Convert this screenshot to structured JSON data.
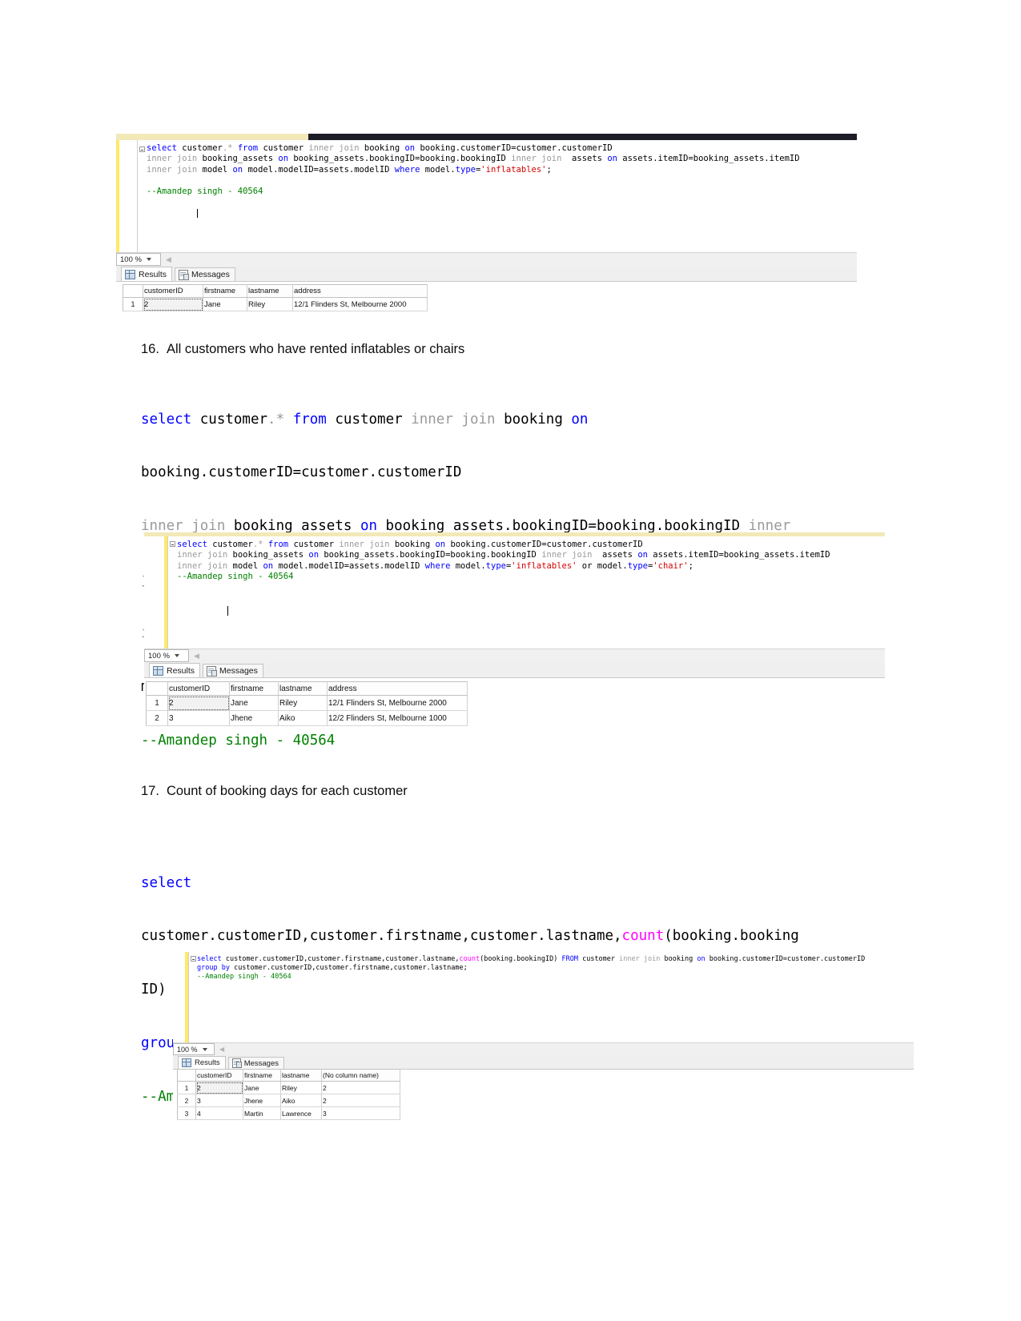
{
  "document": {
    "sections": [
      {
        "number": "16.",
        "title": "All customers who have rented inflatables or chairs",
        "code_lines": [
          [
            {
              "t": "select",
              "c": "kw"
            },
            {
              "t": " customer",
              "c": "pln"
            },
            {
              "t": ".",
              "c": "gray"
            },
            {
              "t": "*",
              "c": "gray"
            },
            {
              "t": " ",
              "c": "pln"
            },
            {
              "t": "from",
              "c": "kw"
            },
            {
              "t": " customer ",
              "c": "pln"
            },
            {
              "t": "inner join",
              "c": "gray"
            },
            {
              "t": " booking ",
              "c": "pln"
            },
            {
              "t": "on",
              "c": "kw"
            }
          ],
          [
            {
              "t": "booking.customerID=customer.customerID",
              "c": "pln"
            }
          ],
          [
            {
              "t": "inner join",
              "c": "gray"
            },
            {
              "t": " booking_assets ",
              "c": "pln"
            },
            {
              "t": "on",
              "c": "kw"
            },
            {
              "t": " booking_assets.bookingID=booking.bookingID ",
              "c": "pln"
            },
            {
              "t": "inner",
              "c": "gray"
            }
          ],
          [
            {
              "t": "join",
              "c": "gray"
            },
            {
              "t": "  assets ",
              "c": "pln"
            },
            {
              "t": "on",
              "c": "kw"
            },
            {
              "t": " assets.itemID=booking_assets.itemID",
              "c": "pln"
            }
          ],
          [
            {
              "t": "inner join",
              "c": "gray"
            },
            {
              "t": " model ",
              "c": "pln"
            },
            {
              "t": "on",
              "c": "kw"
            },
            {
              "t": " model.modelID=assets.modelID ",
              "c": "pln"
            },
            {
              "t": "where",
              "c": "kw"
            }
          ],
          [
            {
              "t": "model.",
              "c": "pln"
            },
            {
              "t": "type",
              "c": "kw"
            },
            {
              "t": "=",
              "c": "pln"
            },
            {
              "t": "'inflatables'",
              "c": "str"
            },
            {
              "t": " or model.",
              "c": "pln"
            },
            {
              "t": "type",
              "c": "kw"
            },
            {
              "t": "=",
              "c": "pln"
            },
            {
              "t": "'chair'",
              "c": "str"
            },
            {
              "t": ";",
              "c": "pln"
            }
          ],
          [
            {
              "t": "--Amandep singh - 40564",
              "c": "cmt"
            }
          ]
        ]
      },
      {
        "number": "17.",
        "title": "Count of booking days for each customer",
        "code_lines": [
          [
            {
              "t": "select",
              "c": "kw"
            }
          ],
          [
            {
              "t": "customer.customerID,customer.firstname,customer.lastname,",
              "c": "pln"
            },
            {
              "t": "count",
              "c": "mag"
            },
            {
              "t": "(booking.booking",
              "c": "pln"
            }
          ],
          [
            {
              "t": "ID) ",
              "c": "pln"
            },
            {
              "t": "FROM",
              "c": "kw"
            },
            {
              "t": " customer ",
              "c": "pln"
            },
            {
              "t": "inner join",
              "c": "gray"
            },
            {
              "t": " booking ",
              "c": "pln"
            },
            {
              "t": "on",
              "c": "kw"
            },
            {
              "t": " booking.customerID=customer.customerID",
              "c": "pln"
            }
          ],
          [
            {
              "t": "group by",
              "c": "kw"
            },
            {
              "t": " customer.customerID,customer.firstname,customer.lastname;",
              "c": "pln"
            }
          ],
          [
            {
              "t": "--Amandep singh - 40564",
              "c": "cmt"
            }
          ]
        ]
      }
    ]
  },
  "screenshot_1": {
    "editor_lines": [
      [
        {
          "t": "select",
          "c": "kw"
        },
        {
          "t": " customer",
          "c": "pln"
        },
        {
          "t": ".*",
          "c": "gray"
        },
        {
          "t": " ",
          "c": "pln"
        },
        {
          "t": "from",
          "c": "kw"
        },
        {
          "t": " customer ",
          "c": "pln"
        },
        {
          "t": "inner join",
          "c": "gray"
        },
        {
          "t": " booking ",
          "c": "pln"
        },
        {
          "t": "on",
          "c": "kw"
        },
        {
          "t": " booking.customerID=customer.customerID",
          "c": "pln"
        }
      ],
      [
        {
          "t": "inner join",
          "c": "gray"
        },
        {
          "t": " booking_assets ",
          "c": "pln"
        },
        {
          "t": "on",
          "c": "kw"
        },
        {
          "t": " booking_assets.bookingID=booking.bookingID ",
          "c": "pln"
        },
        {
          "t": "inner join",
          "c": "gray"
        },
        {
          "t": "  assets ",
          "c": "pln"
        },
        {
          "t": "on",
          "c": "kw"
        },
        {
          "t": " assets.itemID=booking_assets.itemID",
          "c": "pln"
        }
      ],
      [
        {
          "t": "inner join",
          "c": "gray"
        },
        {
          "t": " model ",
          "c": "pln"
        },
        {
          "t": "on",
          "c": "kw"
        },
        {
          "t": " model.modelID=assets.modelID ",
          "c": "pln"
        },
        {
          "t": "where",
          "c": "kw"
        },
        {
          "t": " model.",
          "c": "pln"
        },
        {
          "t": "type",
          "c": "kw"
        },
        {
          "t": "=",
          "c": "pln"
        },
        {
          "t": "'inflatables'",
          "c": "str"
        },
        {
          "t": ";",
          "c": "pln"
        }
      ],
      [],
      [
        {
          "t": "--Amandep singh - 40564",
          "c": "cmt"
        }
      ]
    ],
    "zoom_level": "100 %",
    "tabs": [
      {
        "label": "Results",
        "icon": "grid-icon",
        "active": true
      },
      {
        "label": "Messages",
        "icon": "message-icon",
        "active": false
      }
    ],
    "grid": {
      "columns": [
        "",
        "customerID",
        "firstname",
        "lastname",
        "address"
      ],
      "rows": [
        [
          "1",
          "2",
          "Jane",
          "Riley",
          "12/1 Flinders St, Melbourne 2000"
        ]
      ]
    }
  },
  "screenshot_2": {
    "editor_lines": [
      [
        {
          "t": "select",
          "c": "kw"
        },
        {
          "t": " customer",
          "c": "pln"
        },
        {
          "t": ".*",
          "c": "gray"
        },
        {
          "t": " ",
          "c": "pln"
        },
        {
          "t": "from",
          "c": "kw"
        },
        {
          "t": " customer ",
          "c": "pln"
        },
        {
          "t": "inner join",
          "c": "gray"
        },
        {
          "t": " booking ",
          "c": "pln"
        },
        {
          "t": "on",
          "c": "kw"
        },
        {
          "t": " booking.customerID=customer.customerID",
          "c": "pln"
        }
      ],
      [
        {
          "t": "inner join",
          "c": "gray"
        },
        {
          "t": " booking_assets ",
          "c": "pln"
        },
        {
          "t": "on",
          "c": "kw"
        },
        {
          "t": " booking_assets.bookingID=booking.bookingID ",
          "c": "pln"
        },
        {
          "t": "inner join",
          "c": "gray"
        },
        {
          "t": "  assets ",
          "c": "pln"
        },
        {
          "t": "on",
          "c": "kw"
        },
        {
          "t": " assets.itemID=booking_assets.itemID",
          "c": "pln"
        }
      ],
      [
        {
          "t": "inner join",
          "c": "gray"
        },
        {
          "t": " model ",
          "c": "pln"
        },
        {
          "t": "on",
          "c": "kw"
        },
        {
          "t": " model.modelID=assets.modelID ",
          "c": "pln"
        },
        {
          "t": "where",
          "c": "kw"
        },
        {
          "t": " model.",
          "c": "pln"
        },
        {
          "t": "type",
          "c": "kw"
        },
        {
          "t": "=",
          "c": "pln"
        },
        {
          "t": "'inflatables'",
          "c": "str"
        },
        {
          "t": " or model.",
          "c": "pln"
        },
        {
          "t": "type",
          "c": "kw"
        },
        {
          "t": "=",
          "c": "pln"
        },
        {
          "t": "'chair'",
          "c": "str"
        },
        {
          "t": ";",
          "c": "pln"
        }
      ],
      [
        {
          "t": "--Amandep singh - 40564",
          "c": "cmt"
        }
      ]
    ],
    "zoom_level": "100 %",
    "tabs": [
      {
        "label": "Results",
        "icon": "grid-icon",
        "active": true
      },
      {
        "label": "Messages",
        "icon": "message-icon",
        "active": false
      }
    ],
    "grid": {
      "columns": [
        "",
        "customerID",
        "firstname",
        "lastname",
        "address"
      ],
      "rows": [
        [
          "1",
          "2",
          "Jane",
          "Riley",
          "12/1 Flinders St, Melbourne 2000"
        ],
        [
          "2",
          "3",
          "Jhene",
          "Aiko",
          "12/2 Flinders St, Melbourne 1000"
        ]
      ]
    }
  },
  "screenshot_3": {
    "editor_lines": [
      [
        {
          "t": "select",
          "c": "kw"
        },
        {
          "t": " customer.customerID,customer.firstname,customer.lastname,",
          "c": "pln"
        },
        {
          "t": "count",
          "c": "mag"
        },
        {
          "t": "(booking.bookingID) ",
          "c": "pln"
        },
        {
          "t": "FROM",
          "c": "kw"
        },
        {
          "t": " customer ",
          "c": "pln"
        },
        {
          "t": "inner join",
          "c": "gray"
        },
        {
          "t": " booking ",
          "c": "pln"
        },
        {
          "t": "on",
          "c": "kw"
        },
        {
          "t": " booking.customerID=customer.customerID",
          "c": "pln"
        }
      ],
      [
        {
          "t": "group by",
          "c": "kw"
        },
        {
          "t": " customer.customerID,customer.firstname,customer.lastname;",
          "c": "pln"
        }
      ],
      [
        {
          "t": "--Amandep singh - 40564",
          "c": "cmt"
        }
      ]
    ],
    "zoom_level": "100 %",
    "tabs": [
      {
        "label": "Results",
        "icon": "grid-icon",
        "active": true
      },
      {
        "label": "Messages",
        "icon": "message-icon",
        "active": false
      }
    ],
    "grid": {
      "columns": [
        "",
        "customerID",
        "firstname",
        "lastname",
        "(No column name)"
      ],
      "rows": [
        [
          "1",
          "2",
          "Jane",
          "Riley",
          "2"
        ],
        [
          "2",
          "3",
          "Jhene",
          "Aiko",
          "2"
        ],
        [
          "3",
          "4",
          "Martin",
          "Lawrence",
          "3"
        ]
      ]
    }
  },
  "colors": {
    "keyword": "#0000ff",
    "dim_keyword": "#9a9a9a",
    "string": "#d60000",
    "comment": "#008000",
    "function": "#ff00ff",
    "editor_gutter": "#ffe96b",
    "titlebar": "#1d1d27"
  }
}
